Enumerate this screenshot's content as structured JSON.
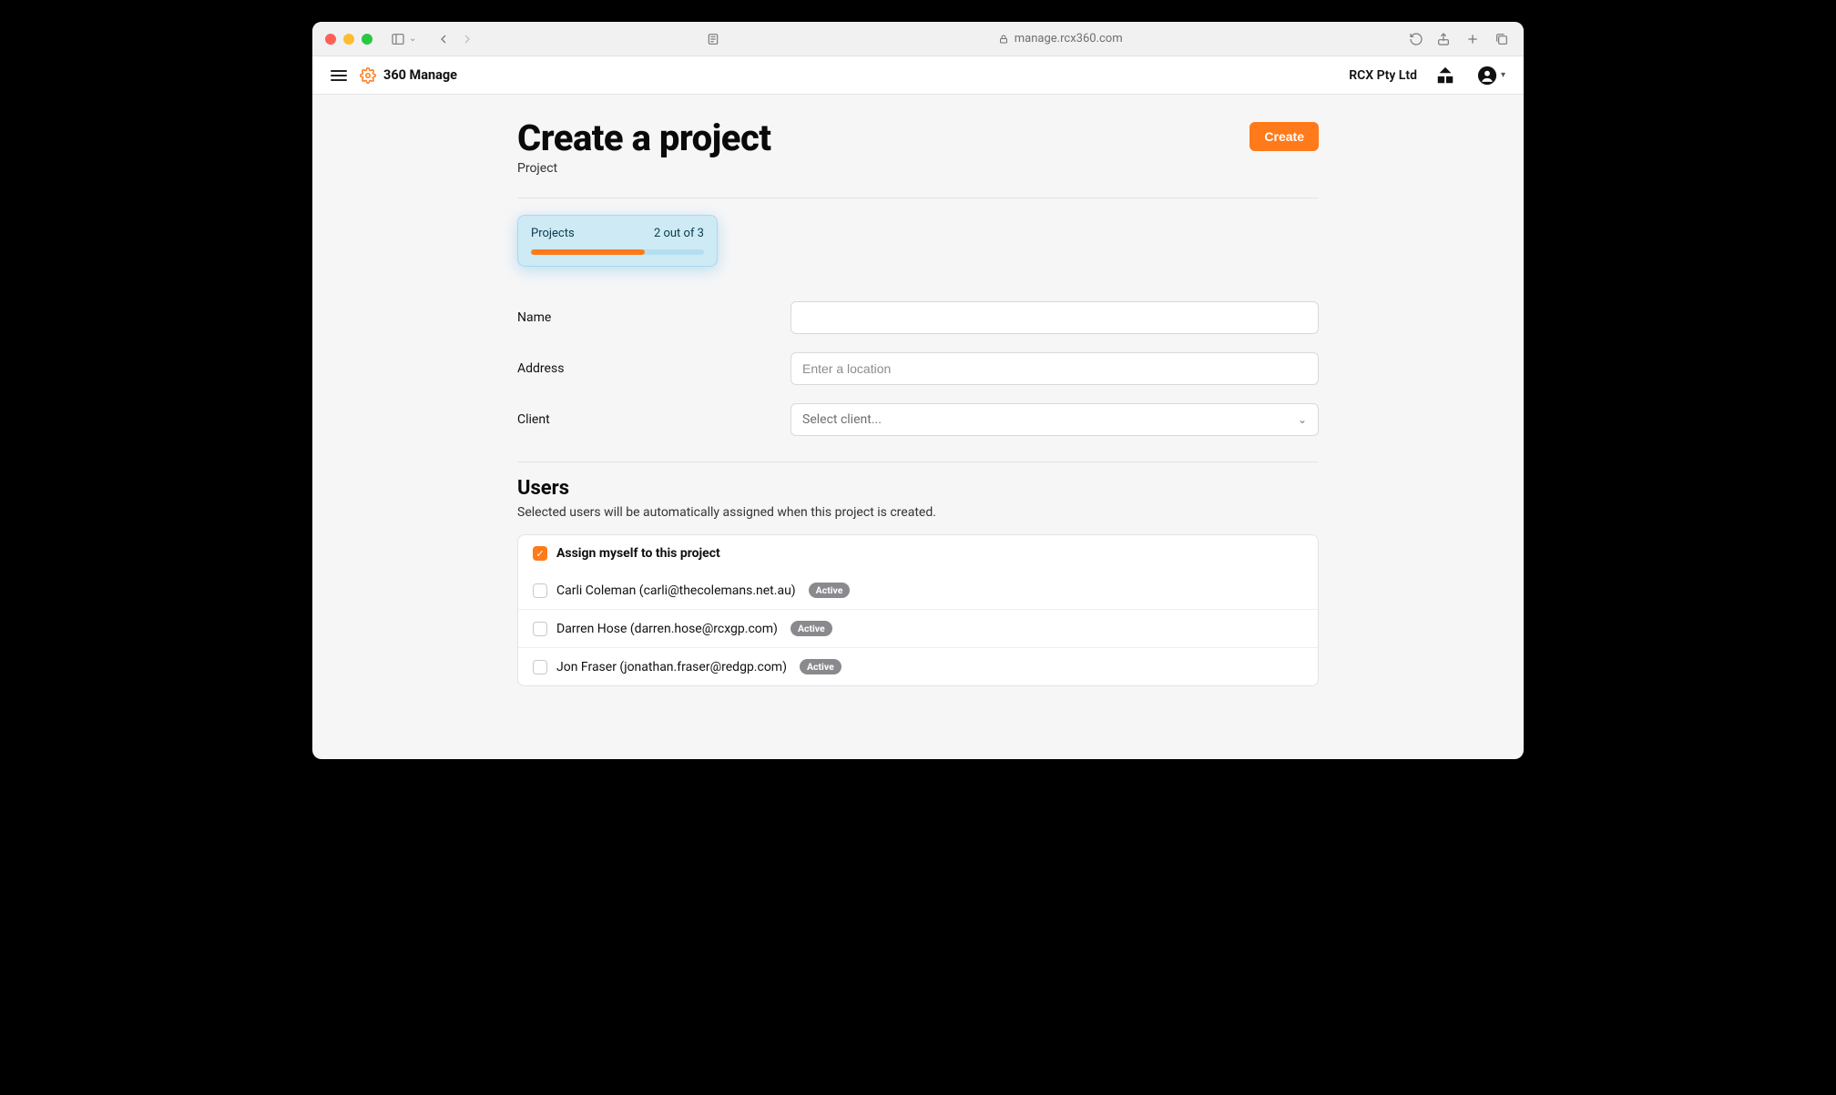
{
  "browser": {
    "url": "manage.rcx360.com"
  },
  "header": {
    "brand": "360 Manage",
    "org": "RCX Pty Ltd"
  },
  "page": {
    "title": "Create a project",
    "subtitle": "Project",
    "create_label": "Create"
  },
  "quota": {
    "label": "Projects",
    "count_text": "2 out of 3",
    "percent": 66
  },
  "fields": {
    "name": {
      "label": "Name",
      "value": ""
    },
    "address": {
      "label": "Address",
      "placeholder": "Enter a location",
      "value": ""
    },
    "client": {
      "label": "Client",
      "placeholder": "Select client..."
    }
  },
  "users_section": {
    "title": "Users",
    "description": "Selected users will be automatically assigned when this project is created.",
    "assign_self_label": "Assign myself to this project",
    "assign_self_checked": true,
    "users": [
      {
        "label": "Carli Coleman (carli@thecolemans.net.au)",
        "badge": "Active",
        "checked": false
      },
      {
        "label": "Darren Hose (darren.hose@rcxgp.com)",
        "badge": "Active",
        "checked": false
      },
      {
        "label": "Jon Fraser (jonathan.fraser@redgp.com)",
        "badge": "Active",
        "checked": false
      }
    ]
  }
}
